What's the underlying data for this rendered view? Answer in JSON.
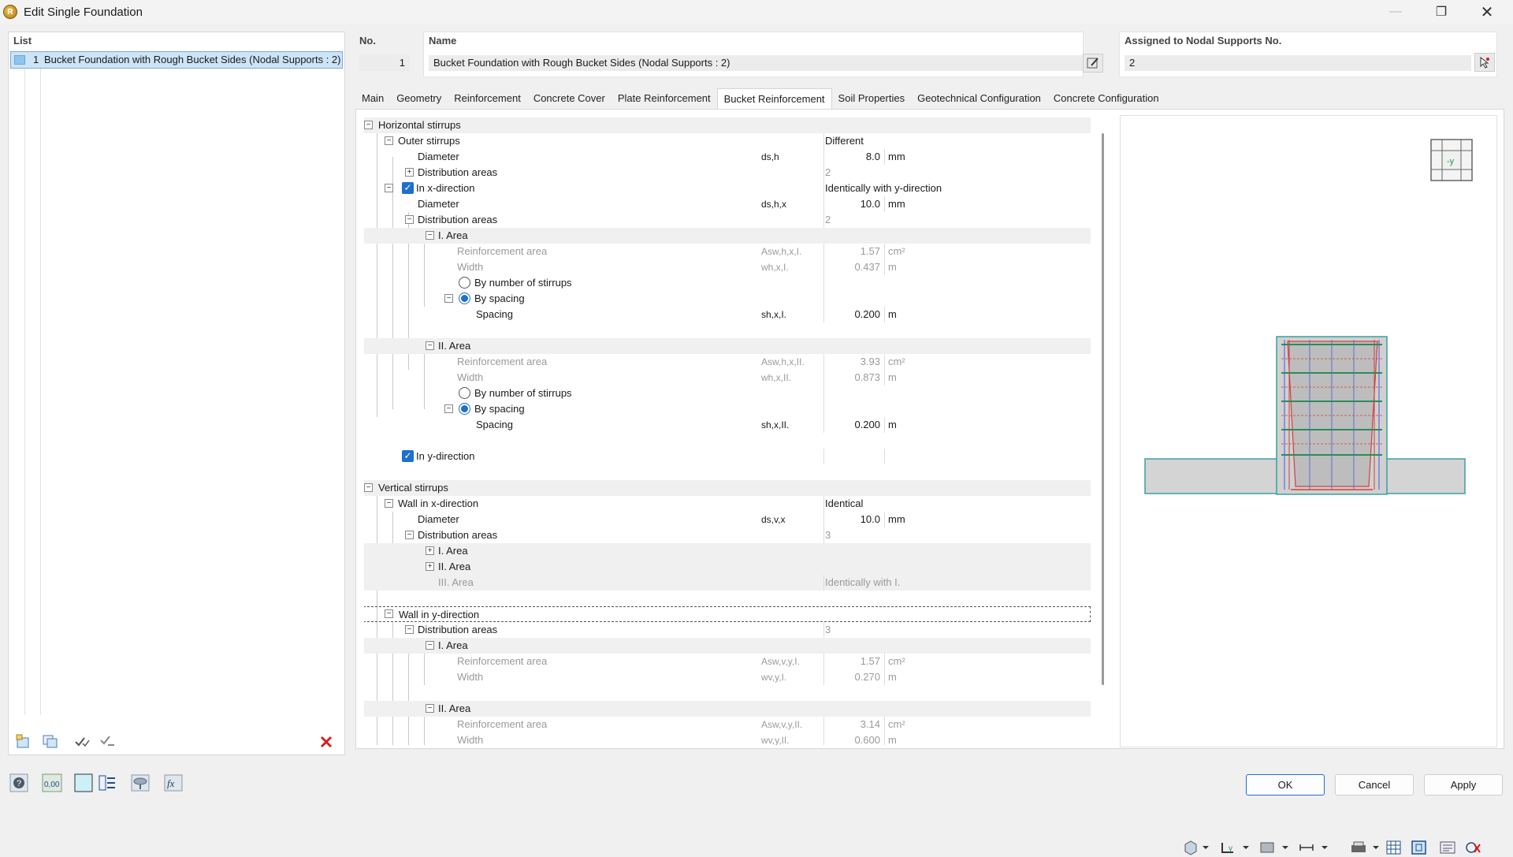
{
  "window": {
    "title": "Edit Single Foundation"
  },
  "list": {
    "header": "List",
    "items": [
      {
        "no": "1",
        "label": "Bucket Foundation with Rough Bucket Sides (Nodal Supports : 2)"
      }
    ]
  },
  "no": {
    "header": "No.",
    "value": "1"
  },
  "name": {
    "header": "Name",
    "value": "Bucket Foundation with Rough Bucket Sides (Nodal Supports : 2)"
  },
  "assigned": {
    "header": "Assigned to Nodal Supports No.",
    "value": "2"
  },
  "tabs": [
    "Main",
    "Geometry",
    "Reinforcement",
    "Concrete Cover",
    "Plate Reinforcement",
    "Bucket Reinforcement",
    "Soil Properties",
    "Geotechnical Configuration",
    "Concrete Configuration"
  ],
  "active_tab": "Bucket Reinforcement",
  "tree": {
    "horizontal_stirrups": "Horizontal stirrups",
    "outer_stirrups": "Outer stirrups",
    "outer_value": "Different",
    "diameter": "Diameter",
    "ds_h_sym": "ds,h",
    "ds_h_val": "8.0",
    "mm": "mm",
    "distribution_areas": "Distribution areas",
    "outer_dist_val": "2",
    "in_x": "In x-direction",
    "in_x_value": "Identically with y-direction",
    "ds_hx_sym": "ds,h,x",
    "ds_hx_val": "10.0",
    "x_dist_val": "2",
    "area1": "I. Area",
    "area2": "II. Area",
    "area3": "III. Area",
    "reinf_area": "Reinforcement area",
    "width": "Width",
    "by_number": "By number of stirrups",
    "by_spacing": "By spacing",
    "spacing": "Spacing",
    "a1_reinf_sym": "Asw,h,x,I.",
    "a1_reinf_val": "1.57",
    "cm2": "cm²",
    "a1_width_sym": "wh,x,I.",
    "a1_width_val": "0.437",
    "m": "m",
    "a1_spacing_sym": "sh,x,I.",
    "a1_spacing_val": "0.200",
    "a2_reinf_sym": "Asw,h,x,II.",
    "a2_reinf_val": "3.93",
    "a2_width_sym": "wh,x,II.",
    "a2_width_val": "0.873",
    "a2_spacing_sym": "sh,x,II.",
    "a2_spacing_val": "0.200",
    "in_y": "In y-direction",
    "vertical_stirrups": "Vertical stirrups",
    "wall_x": "Wall in x-direction",
    "wall_x_value": "Identical",
    "ds_vx_sym": "ds,v,x",
    "ds_vx_val": "10.0",
    "wx_dist_val": "3",
    "area3_value": "Identically with I.",
    "wall_y": "Wall in y-direction",
    "wy_dist_val": "3",
    "wy_a1_reinf_sym": "Asw,v,y,I.",
    "wy_a1_reinf_val": "1.57",
    "wy_a1_width_sym": "wv,y,I.",
    "wy_a1_width_val": "0.270",
    "wy_a2_reinf_sym": "Asw,v,y,II.",
    "wy_a2_reinf_val": "3.14",
    "wy_a2_width_sym": "wv,y,II.",
    "wy_a2_width_val": "0.600"
  },
  "preview": {
    "view_cube_label": "-y"
  },
  "buttons": {
    "ok": "OK",
    "cancel": "Cancel",
    "apply": "Apply"
  },
  "colors": {
    "accent": "#1e6fd0",
    "concrete": "#d4d4d4",
    "rebar_green": "#2e8b57",
    "rebar_red": "#d04040",
    "rebar_blue": "#5a6fd6"
  }
}
